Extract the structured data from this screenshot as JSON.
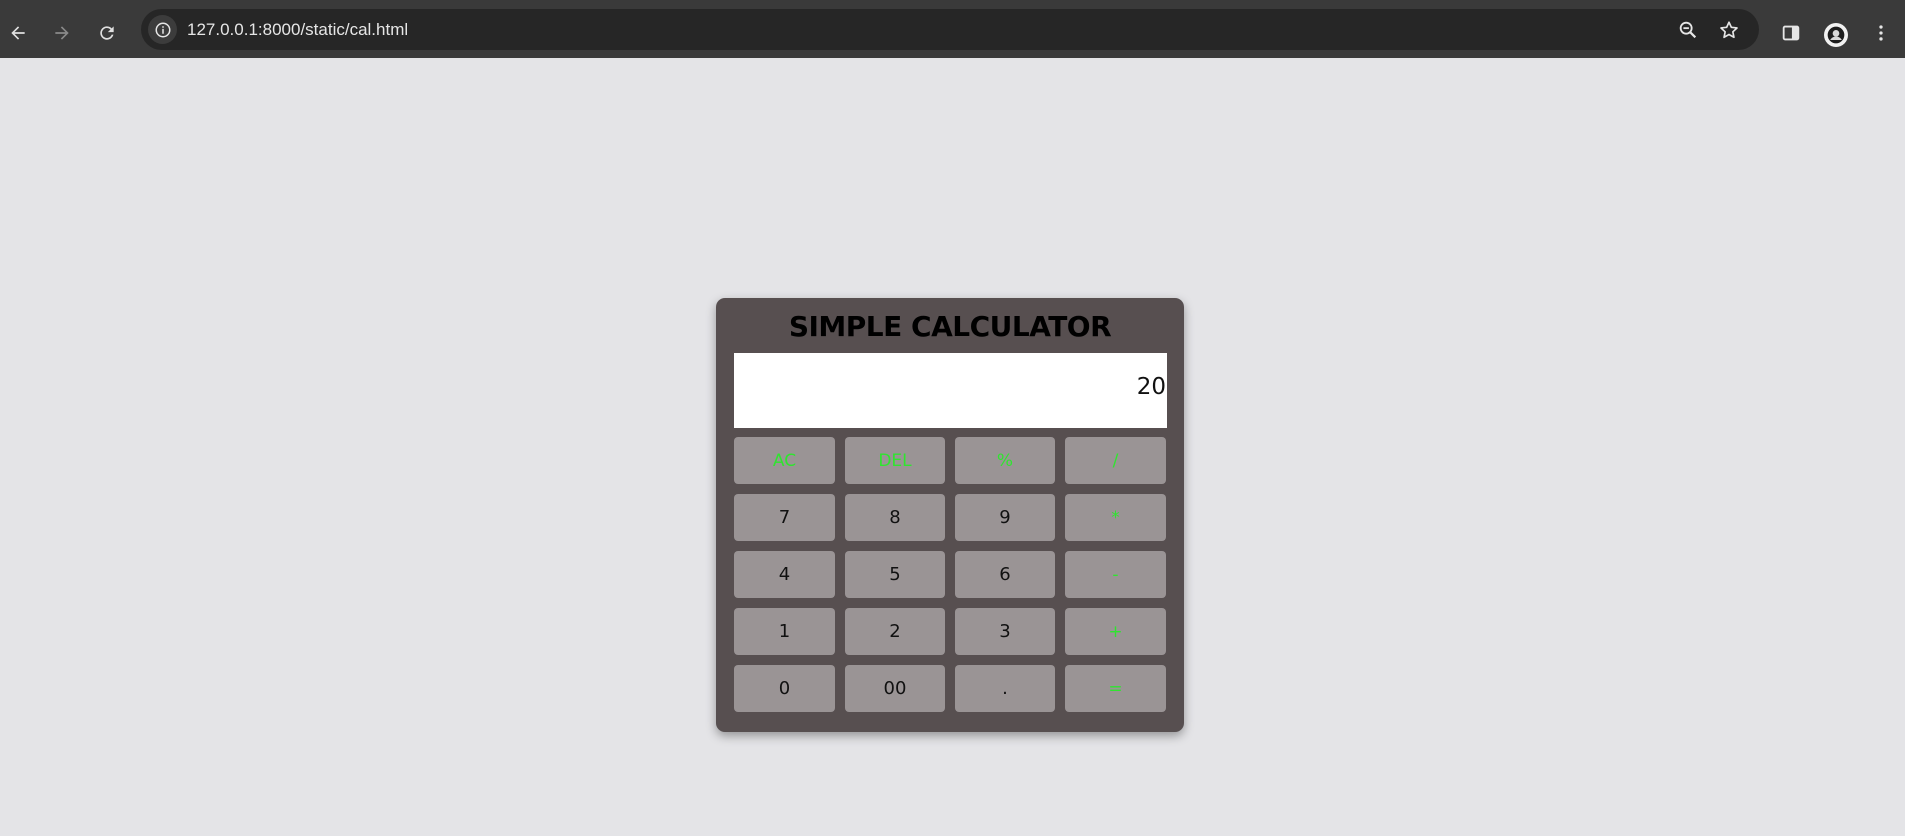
{
  "browser": {
    "url": "127.0.0.1:8000/static/cal.html",
    "icons": {
      "back": "back-arrow-icon",
      "forward": "forward-arrow-icon",
      "reload": "reload-icon",
      "site_info": "info-icon",
      "zoom": "zoom-out-icon",
      "bookmark": "star-icon",
      "side_panel": "side-panel-icon",
      "profile": "avatar",
      "menu": "kebab-menu-icon"
    }
  },
  "calculator": {
    "title": "SIMPLE CALCULATOR",
    "display_value": "20",
    "keys": [
      {
        "label": "AC",
        "type": "op"
      },
      {
        "label": "DEL",
        "type": "op"
      },
      {
        "label": "%",
        "type": "op"
      },
      {
        "label": "/",
        "type": "op"
      },
      {
        "label": "7",
        "type": "num"
      },
      {
        "label": "8",
        "type": "num"
      },
      {
        "label": "9",
        "type": "num"
      },
      {
        "label": "*",
        "type": "op"
      },
      {
        "label": "4",
        "type": "num"
      },
      {
        "label": "5",
        "type": "num"
      },
      {
        "label": "6",
        "type": "num"
      },
      {
        "label": "-",
        "type": "op"
      },
      {
        "label": "1",
        "type": "num"
      },
      {
        "label": "2",
        "type": "num"
      },
      {
        "label": "3",
        "type": "num"
      },
      {
        "label": "+",
        "type": "op"
      },
      {
        "label": "0",
        "type": "num"
      },
      {
        "label": "00",
        "type": "num"
      },
      {
        "label": ".",
        "type": "num"
      },
      {
        "label": "=",
        "type": "op"
      }
    ]
  },
  "colors": {
    "page_background": "#e4e4e7",
    "calculator_body": "#574f50",
    "key_background": "#9a9495",
    "operator_text": "#2fe52f",
    "number_text": "#111111"
  }
}
